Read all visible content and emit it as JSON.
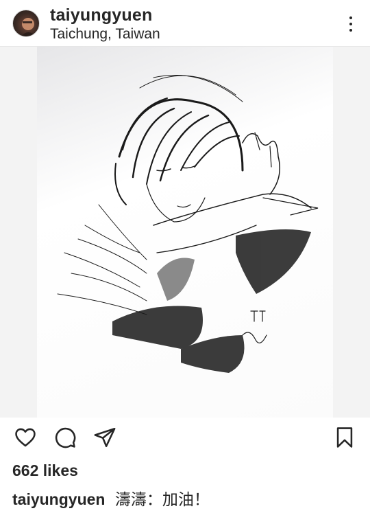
{
  "header": {
    "username": "taiyungyuen",
    "location": "Taichung, Taiwan",
    "more_icon": "more-vertical-icon",
    "avatar_icon": "profile-avatar"
  },
  "post": {
    "image_description_icon": "pencil-sketch-artwork",
    "likes": "662 likes",
    "caption_user": "taiyungyuen",
    "caption_text": "濤濤：加油！"
  },
  "actions": {
    "like_icon": "heart-icon",
    "comment_icon": "comment-icon",
    "share_icon": "send-icon",
    "save_icon": "bookmark-icon"
  },
  "colors": {
    "text": "#262626",
    "divider": "#e6e6e6",
    "background": "#ffffff"
  }
}
